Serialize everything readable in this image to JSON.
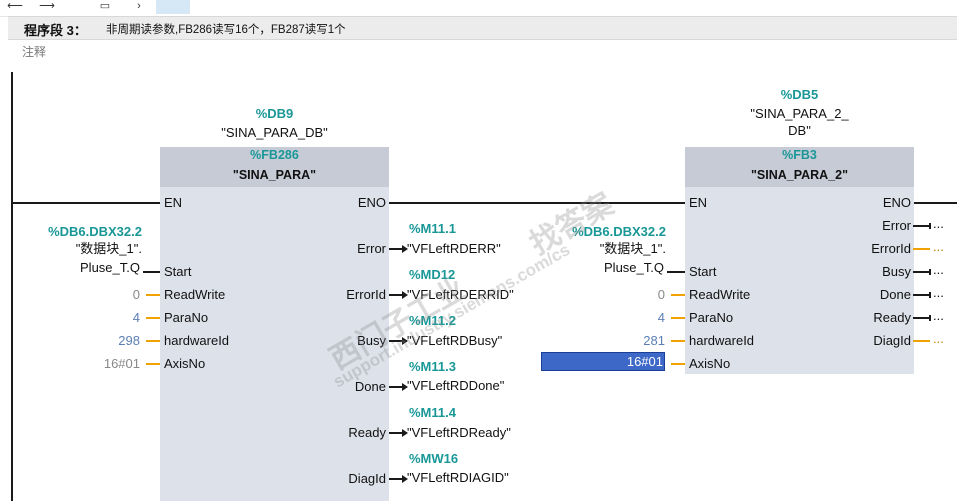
{
  "network": {
    "title": "程序段 3：",
    "description": "非周期读参数,FB286读写16个，FB287读写1个",
    "comment": "注释"
  },
  "watermark": {
    "line1": "西门子工业",
    "line2": "support.industry.siemens.com/cs",
    "line3": "找答案"
  },
  "block1": {
    "db_addr": "%DB9",
    "db_name": "\"SINA_PARA_DB\"",
    "fb_addr": "%FB286",
    "fb_name": "\"SINA_PARA\"",
    "en": "EN",
    "eno": "ENO",
    "inputs": {
      "start": {
        "pin": "Start",
        "addr": "%DB6.DBX32.2",
        "name1": "\"数据块_1\".",
        "name2": "Pluse_T.Q"
      },
      "readwrite": {
        "pin": "ReadWrite",
        "value": "0"
      },
      "parano": {
        "pin": "ParaNo",
        "value": "4"
      },
      "hardwareid": {
        "pin": "hardwareId",
        "value": "298"
      },
      "axisno": {
        "pin": "AxisNo",
        "value": "16#01"
      }
    },
    "outputs": {
      "error": {
        "pin": "Error",
        "addr": "%M11.1",
        "name": "\"VFLeftRDERR\""
      },
      "errorid": {
        "pin": "ErrorId",
        "addr": "%MD12",
        "name": "\"VFLeftRDERRID\""
      },
      "busy": {
        "pin": "Busy",
        "addr": "%M11.2",
        "name": "\"VFLeftRDBusy\""
      },
      "done": {
        "pin": "Done",
        "addr": "%M11.3",
        "name": "\"VFLeftRDDone\""
      },
      "ready": {
        "pin": "Ready",
        "addr": "%M11.4",
        "name": "\"VFLeftRDReady\""
      },
      "diagid": {
        "pin": "DiagId",
        "addr": "%MW16",
        "name": "\"VFLeftRDIAGID\""
      }
    }
  },
  "block2": {
    "db_addr": "%DB5",
    "db_name1": "\"SINA_PARA_2_",
    "db_name2": "DB\"",
    "fb_addr": "%FB3",
    "fb_name": "\"SINA_PARA_2\"",
    "en": "EN",
    "eno": "ENO",
    "inputs": {
      "start": {
        "pin": "Start",
        "addr": "%DB6.DBX32.2",
        "name1": "\"数据块_1\".",
        "name2": "Pluse_T.Q"
      },
      "readwrite": {
        "pin": "ReadWrite",
        "value": "0"
      },
      "parano": {
        "pin": "ParaNo",
        "value": "4"
      },
      "hardwareid": {
        "pin": "hardwareId",
        "value": "281"
      },
      "axisno": {
        "pin": "AxisNo",
        "value": "16#01"
      }
    },
    "outputs": {
      "error": {
        "pin": "Error",
        "value": "..."
      },
      "errorid": {
        "pin": "ErrorId",
        "value": "..."
      },
      "busy": {
        "pin": "Busy",
        "value": "..."
      },
      "done": {
        "pin": "Done",
        "value": "..."
      },
      "ready": {
        "pin": "Ready",
        "value": "..."
      },
      "diagid": {
        "pin": "DiagId",
        "value": "..."
      }
    }
  },
  "colors": {
    "address": "#199797",
    "selection": "#3d68c8",
    "unconnected_stub": "#f0a200",
    "box_body": "#dde1ea",
    "box_header": "#c6cbd6"
  },
  "icons": [
    "arrow-icon",
    "arrow-icon",
    "copy-icon",
    "arrow-right-icon"
  ]
}
